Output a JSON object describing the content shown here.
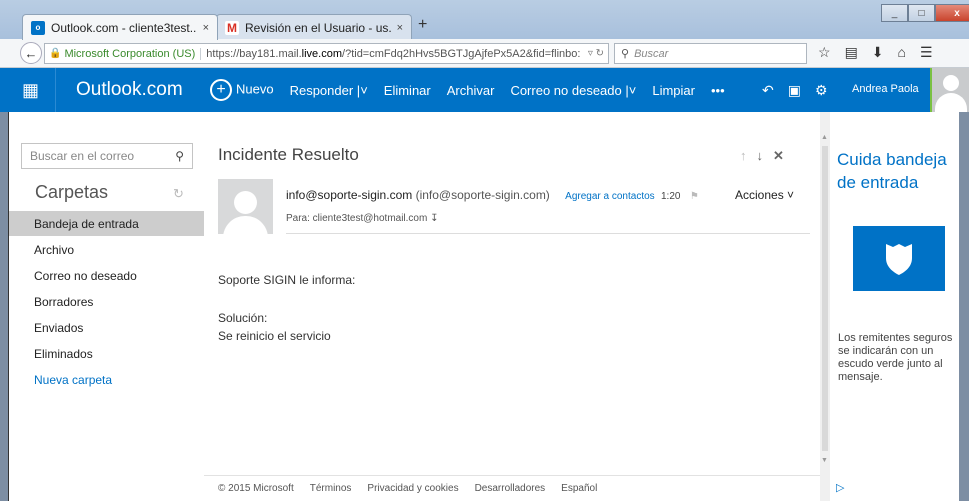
{
  "browser": {
    "tabs": [
      {
        "title": "Outlook.com - cliente3test...",
        "close": "×",
        "favicon": "outlook-favicon",
        "active": true
      },
      {
        "title": "Revisión en el Usuario - us...",
        "close": "×",
        "favicon": "gmail-favicon",
        "active": false
      }
    ],
    "new_tab": "+",
    "window_controls": {
      "minimize": "_",
      "maximize": "□",
      "close": "x"
    },
    "identity": "Microsoft Corporation (US)",
    "url_prefix": "https://bay181.mail.",
    "url_domain": "live.com",
    "url_suffix": "/?tid=cmFdq2hHvs5BGTJgAjfePx5A2&fid=flinbo:",
    "search_placeholder": "Buscar",
    "nav_icons": [
      "star-icon",
      "reading-list-icon",
      "download-icon",
      "home-icon",
      "menu-icon"
    ]
  },
  "outlook": {
    "brand": "Outlook.com",
    "commands": {
      "new": "Nuevo",
      "reply": "Responder",
      "delete": "Eliminar",
      "archive": "Archivar",
      "junk": "Correo no deseado",
      "clean": "Limpiar",
      "more": "•••"
    },
    "user_name": "Andrea Paola",
    "accent_color": "#0072c6"
  },
  "left": {
    "search_placeholder": "Buscar en el correo",
    "folders_title": "Carpetas",
    "folders": [
      {
        "label": "Bandeja de entrada",
        "selected": true
      },
      {
        "label": "Archivo"
      },
      {
        "label": "Correo no deseado"
      },
      {
        "label": "Borradores"
      },
      {
        "label": "Enviados"
      },
      {
        "label": "Eliminados"
      }
    ],
    "new_folder": "Nueva carpeta"
  },
  "message": {
    "subject": "Incidente Resuelto",
    "from_email": "info@soporte-sigin.com",
    "from_display": "(info@soporte-sigin.com)",
    "add_contact": "Agregar a contactos",
    "time": "1:20",
    "actions": "Acciones",
    "to": "Para: cliente3test@hotmail.com",
    "body": {
      "greeting": "Soporte SIGIN le informa:",
      "label": "Solución:",
      "text": "Se reinicio el servicio"
    }
  },
  "footer": {
    "copyright": "© 2015 Microsoft",
    "terms": "Términos",
    "privacy": "Privacidad y cookies",
    "developers": "Desarrolladores",
    "language": "Español"
  },
  "right": {
    "title": "Cuida bandeja de entrada",
    "text": "Los remitentes seguros se indicarán con un escudo verde junto al mensaje."
  }
}
